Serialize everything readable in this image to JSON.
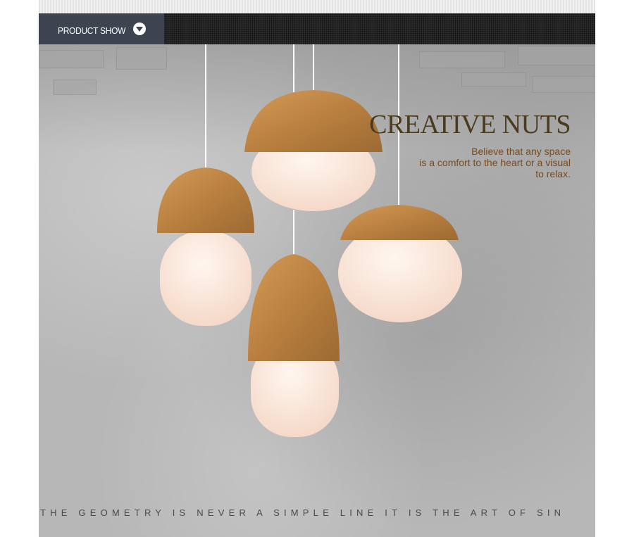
{
  "header": {
    "title": "PRODUCT SHOW",
    "chevron_icon": "chevron-down-icon"
  },
  "banner": {
    "headline": "CREATIVE NUTS",
    "tagline_lines": [
      "Believe that any space",
      "is a comfort to the heart or a visual",
      "to relax."
    ],
    "footer": "THE GEOMETRY IS NEVER A SIMPLE LINE IT IS THE ART OF SIN"
  },
  "colors": {
    "header_bg": "#2c2c2c",
    "tab_bg": "#3d4450",
    "wood": "#c08a4c",
    "glass": "#fbe8dc",
    "headline": "#4a3a1e",
    "tagline": "#7a4a1a"
  }
}
